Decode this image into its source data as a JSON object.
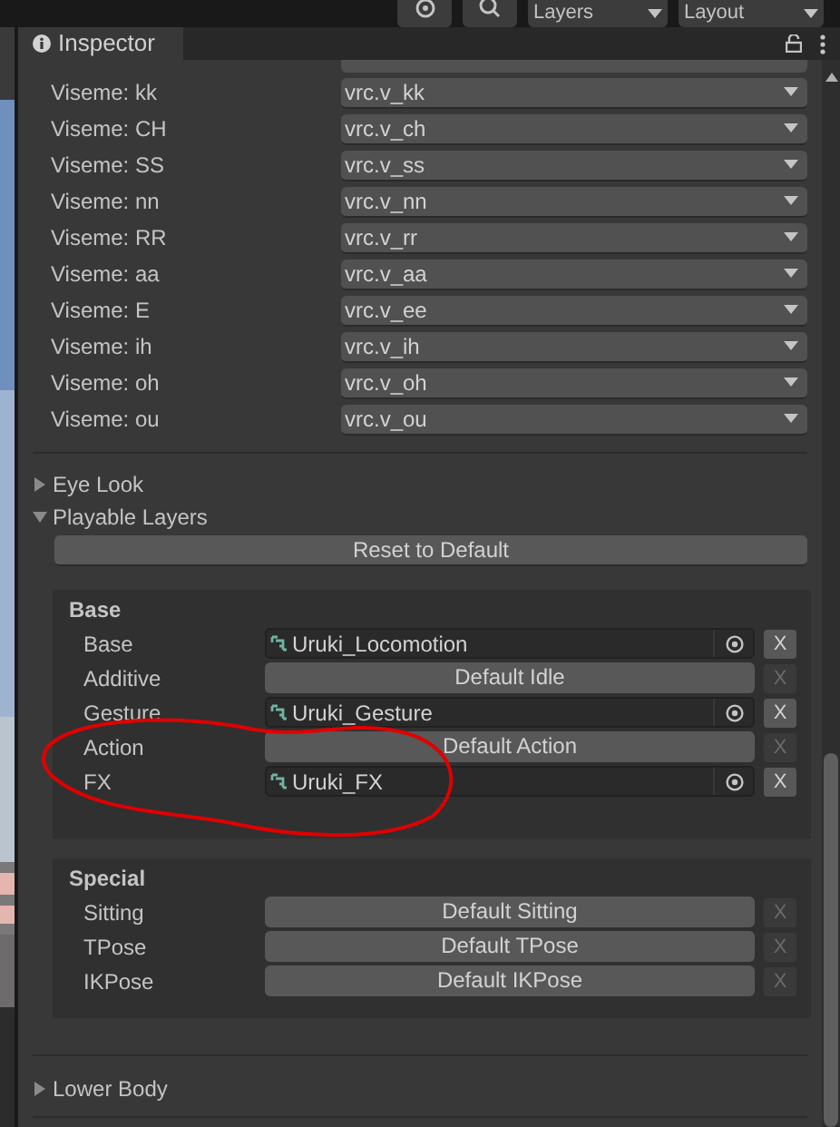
{
  "toolbar": {
    "dropdowns": [
      {
        "label": "Layers"
      },
      {
        "label": "Layout"
      }
    ]
  },
  "inspector": {
    "tab": {
      "title": "Inspector",
      "selected": true
    }
  },
  "visemes": [
    {
      "label": "Viseme: kk",
      "value": "vrc.v_kk"
    },
    {
      "label": "Viseme: CH",
      "value": "vrc.v_ch"
    },
    {
      "label": "Viseme: SS",
      "value": "vrc.v_ss"
    },
    {
      "label": "Viseme: nn",
      "value": "vrc.v_nn"
    },
    {
      "label": "Viseme: RR",
      "value": "vrc.v_rr"
    },
    {
      "label": "Viseme: aa",
      "value": "vrc.v_aa"
    },
    {
      "label": "Viseme: E",
      "value": "vrc.v_ee"
    },
    {
      "label": "Viseme: ih",
      "value": "vrc.v_ih"
    },
    {
      "label": "Viseme: oh",
      "value": "vrc.v_oh"
    },
    {
      "label": "Viseme: ou",
      "value": "vrc.v_ou"
    }
  ],
  "foldouts": [
    {
      "label": "Eye Look",
      "expanded": false
    },
    {
      "label": "Playable Layers",
      "expanded": true
    }
  ],
  "reset_button": "Reset to Default",
  "groups": [
    {
      "title": "Base",
      "layers": [
        {
          "label": "Base",
          "kind": "object",
          "value": "Uruki_Locomotion",
          "clear": "X",
          "disabled": false
        },
        {
          "label": "Additive",
          "kind": "default",
          "value": "Default Idle",
          "clear": "X",
          "disabled": true
        },
        {
          "label": "Gesture",
          "kind": "object",
          "value": "Uruki_Gesture",
          "clear": "X",
          "disabled": false
        },
        {
          "label": "Action",
          "kind": "default",
          "value": "Default Action",
          "clear": "X",
          "disabled": true
        },
        {
          "label": "FX",
          "kind": "object",
          "value": "Uruki_FX",
          "clear": "X",
          "disabled": false
        }
      ]
    },
    {
      "title": "Special",
      "layers": [
        {
          "label": "Sitting",
          "kind": "default",
          "value": "Default Sitting",
          "clear": "X",
          "disabled": true
        },
        {
          "label": "TPose",
          "kind": "default",
          "value": "Default TPose",
          "clear": "X",
          "disabled": true
        },
        {
          "label": "IKPose",
          "kind": "default",
          "value": "Default IKPose",
          "clear": "X",
          "disabled": true
        }
      ]
    }
  ],
  "bottom_foldouts": [
    {
      "label": "Lower Body",
      "expanded": false
    }
  ]
}
